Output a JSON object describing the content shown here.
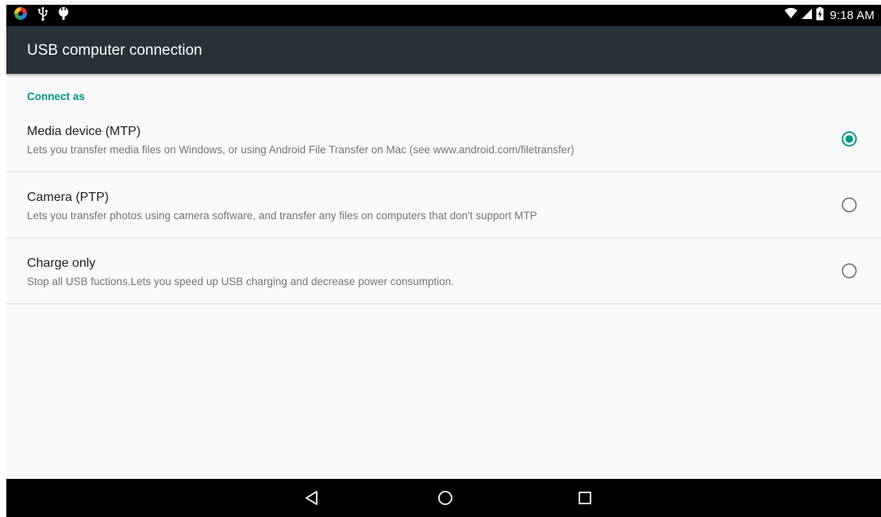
{
  "status_bar": {
    "left_icons": [
      "app-notification-icon",
      "usb-icon",
      "usb-debugging-icon"
    ],
    "right_icons": [
      "wifi-icon",
      "cellular-signal-icon",
      "battery-charging-icon"
    ],
    "time": "9:18 AM"
  },
  "app_bar": {
    "title": "USB computer connection"
  },
  "settings": {
    "section_header": "Connect as",
    "options": [
      {
        "title": "Media device (MTP)",
        "summary": "Lets you transfer media files on Windows, or using Android File Transfer on Mac (see www.android.com/filetransfer)",
        "selected": true
      },
      {
        "title": "Camera (PTP)",
        "summary": "Lets you transfer photos using camera software, and transfer any files on computers that don't support MTP",
        "selected": false
      },
      {
        "title": "Charge only",
        "summary": "Stop all USB fuctions.Lets you speed up USB charging and decrease power consumption.",
        "selected": false
      }
    ]
  },
  "nav_bar": {
    "buttons": [
      "back-icon",
      "home-icon",
      "recents-icon"
    ]
  },
  "colors": {
    "accent": "#009688",
    "app_bar": "#263238",
    "status_bar": "#000000",
    "nav_bar": "#000000"
  }
}
